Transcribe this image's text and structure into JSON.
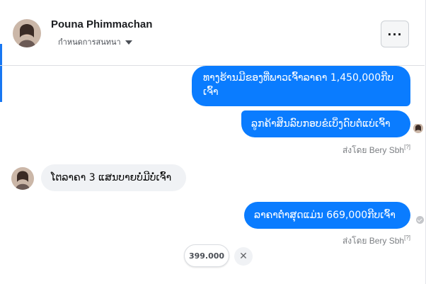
{
  "header": {
    "name": "Pouna Phimmachan",
    "subtitle": "กำหนดการสนทนา",
    "more_label": "···"
  },
  "messages": [
    {
      "direction": "outgoing",
      "text": "ທາງຮ້ານມີຂອງທີ່ພາວເຈົ້າລາຄາ 1,450,000ກີບ ເຈົ້າ"
    },
    {
      "direction": "outgoing",
      "text": "ລູກຄ້າສິນລົບກອບຂໍເບິ່ງດົບຕໍ່ແບ່ເຈົ້າ"
    },
    {
      "direction": "incoming",
      "text": "ໂຕລາຄາ 3 ແສນບາຍບໍ່ມີບໍ່ເຈົ້າ"
    },
    {
      "direction": "outgoing",
      "text": "ລາຄາຕ່ຳສຸດແມ່ນ 669,000ກີບເຈົ້າ"
    }
  ],
  "sent_by": {
    "prefix": "ส่งโดย Bery Sbh",
    "mark": "[?]"
  },
  "chip": {
    "value": "399.000"
  },
  "close_symbol": "✕",
  "colors": {
    "outgoing_bubble": "#0a7cff",
    "incoming_bubble": "#f0f2f5",
    "accent": "#1877f2"
  }
}
